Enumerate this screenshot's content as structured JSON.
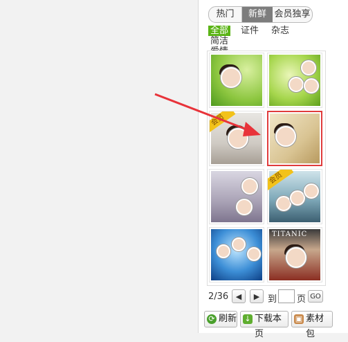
{
  "tabs": [
    {
      "label": "热门"
    },
    {
      "label": "新鲜"
    },
    {
      "label": "会员独享"
    }
  ],
  "categories": [
    "全部",
    "证件",
    "杂志",
    "简洁",
    "爱情"
  ],
  "thumbnails": [
    {
      "badge": ""
    },
    {
      "badge": ""
    },
    {
      "badge": "会员"
    },
    {
      "badge": ""
    },
    {
      "badge": ""
    },
    {
      "badge": "会员"
    },
    {
      "badge": ""
    },
    {
      "badge": "",
      "title": "TITANIC"
    }
  ],
  "pager": {
    "page_info": "2/36",
    "prev_icon": "◀",
    "next_icon": "▶",
    "to_label": "到",
    "page_input_value": "",
    "page_unit": "页",
    "go_label": "GO"
  },
  "actions": {
    "refresh_label": "刷新",
    "download_label": "下载本页",
    "material_label": "素材包"
  },
  "colors": {
    "active_category_bg": "#5bb416",
    "active_tab_bg": "#7d7d7d",
    "selected_border": "#e03c3c",
    "annotation_arrow": "#e8333a"
  }
}
